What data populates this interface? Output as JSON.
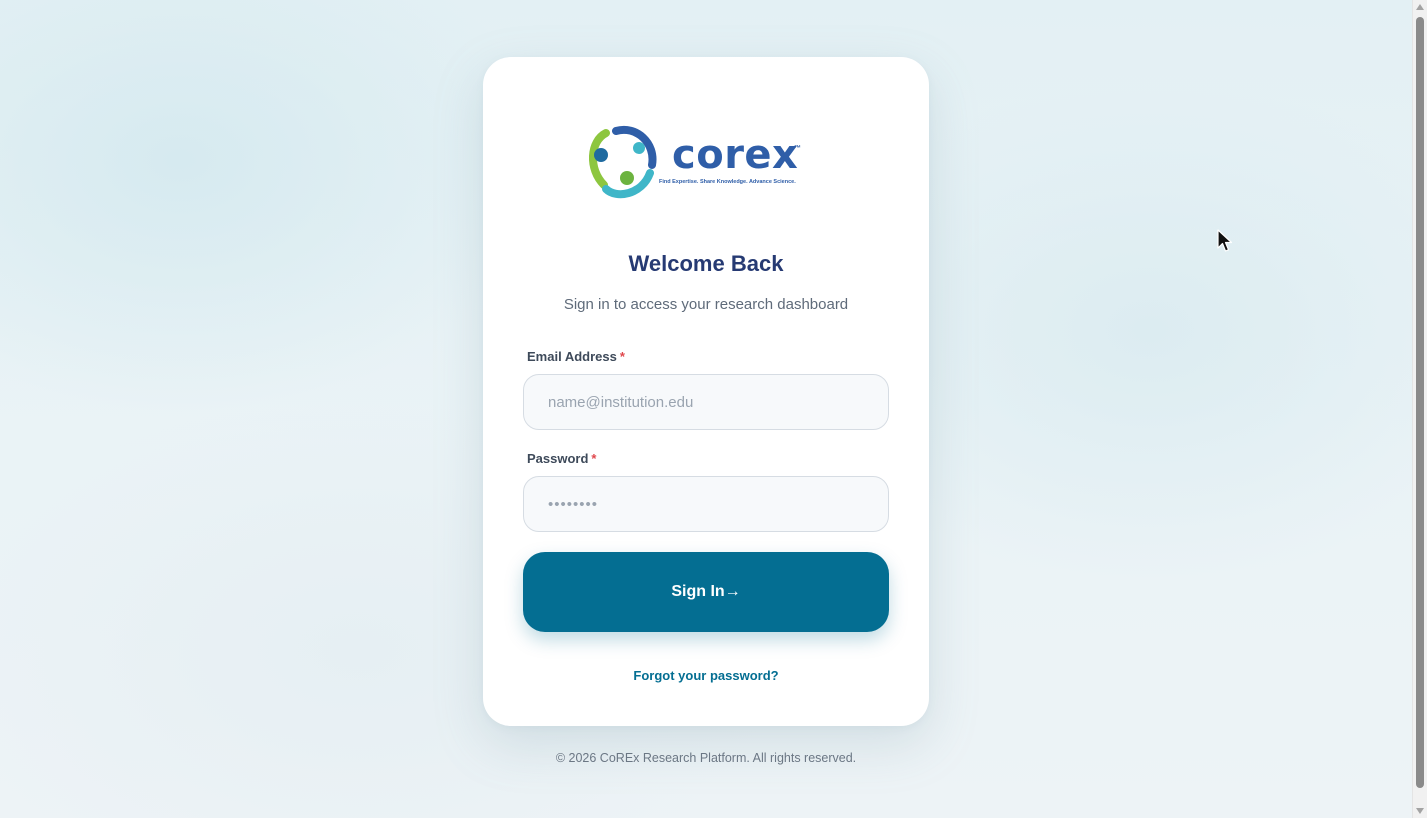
{
  "brand": {
    "name": "corex",
    "trademark": "™",
    "tagline": "Find Expertise. Share Knowledge. Advance Science.",
    "colors": {
      "primary": "#046e92",
      "heading": "#263a73",
      "logo_blue": "#2f5ea8",
      "logo_green": "#8dc63f",
      "logo_teal": "#3fb6c8",
      "required": "#e0474c"
    }
  },
  "login": {
    "title": "Welcome Back",
    "subtitle": "Sign in to access your research dashboard",
    "email": {
      "label": "Email Address",
      "required_marker": "*",
      "placeholder": "name@institution.edu",
      "value": ""
    },
    "password": {
      "label": "Password",
      "required_marker": "*",
      "placeholder": "••••••••",
      "value": ""
    },
    "submit_label": "Sign In→",
    "forgot_label": "Forgot your password?"
  },
  "footer": {
    "copyright": "© 2026 CoREx Research Platform. All rights reserved."
  },
  "icons": {
    "logo": "corex-logo-icon",
    "cursor": "mouse-pointer-icon",
    "scroll_up": "scroll-up-arrow-icon",
    "scroll_down": "scroll-down-arrow-icon"
  }
}
